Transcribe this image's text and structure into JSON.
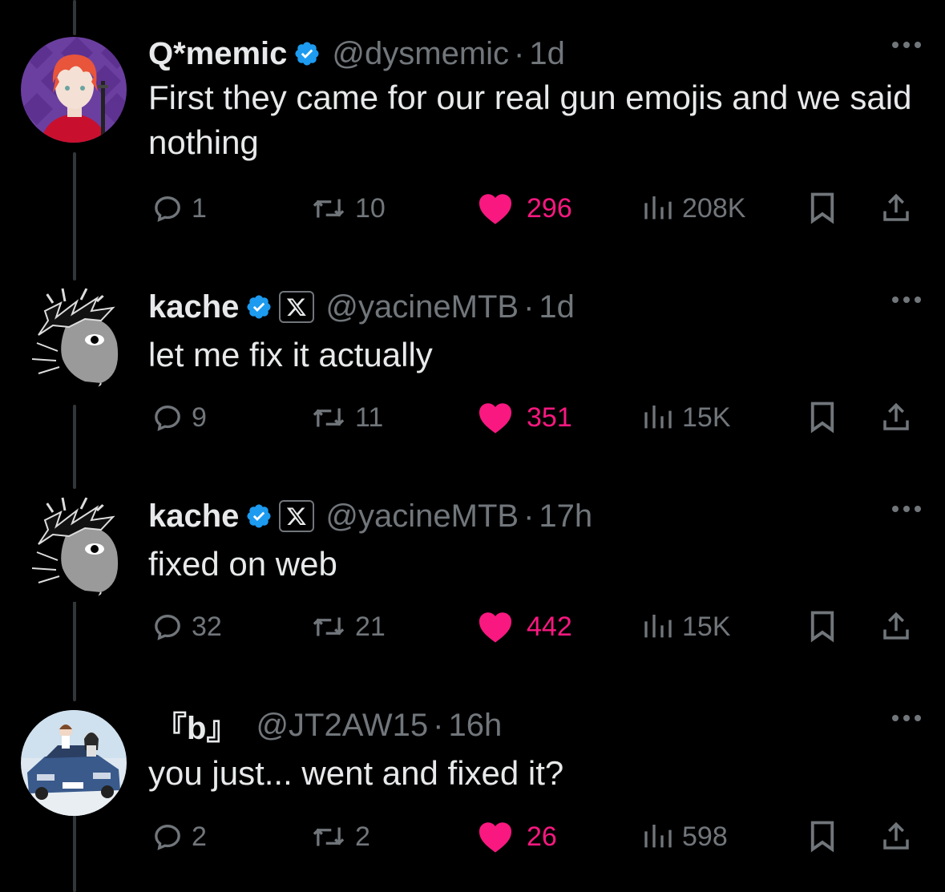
{
  "tweets": [
    {
      "name": "Q*memic",
      "verified": true,
      "affiliate_badge": false,
      "handle": "@dysmemic",
      "separator": "·",
      "time": "1d",
      "text": "First they came for our real gun emojis and we said nothing",
      "replies": "1",
      "reposts": "10",
      "likes": "296",
      "views": "208K",
      "avatar": "red-hair-anime-avatar"
    },
    {
      "name": "kache",
      "verified": true,
      "affiliate_badge": true,
      "affiliate_label": "X",
      "handle": "@yacineMTB",
      "separator": "·",
      "time": "1d",
      "text": "let me fix it actually",
      "replies": "9",
      "reposts": "11",
      "likes": "351",
      "views": "15K",
      "avatar": "manga-face-avatar"
    },
    {
      "name": "kache",
      "verified": true,
      "affiliate_badge": true,
      "affiliate_label": "X",
      "handle": "@yacineMTB",
      "separator": "·",
      "time": "17h",
      "text": "fixed on web",
      "replies": "32",
      "reposts": "21",
      "likes": "442",
      "views": "15K",
      "avatar": "manga-face-avatar"
    },
    {
      "name": "『b』",
      "verified": false,
      "affiliate_badge": false,
      "handle": "@JT2AW15",
      "separator": "·",
      "time": "16h",
      "text": "you just... went and fixed it?",
      "replies": "2",
      "reposts": "2",
      "likes": "26",
      "views": "598",
      "avatar": "anime-car-avatar"
    }
  ],
  "colors": {
    "background": "#000000",
    "primary_text": "#e7e9ea",
    "secondary_text": "#71767b",
    "like": "#f91880",
    "verified": "#1d9bf0",
    "thread_line": "#333639"
  },
  "icons": [
    "reply-icon",
    "repost-icon",
    "heart-icon",
    "views-icon",
    "bookmark-icon",
    "share-icon",
    "more-icon",
    "verified-badge-icon",
    "x-affiliate-icon"
  ]
}
